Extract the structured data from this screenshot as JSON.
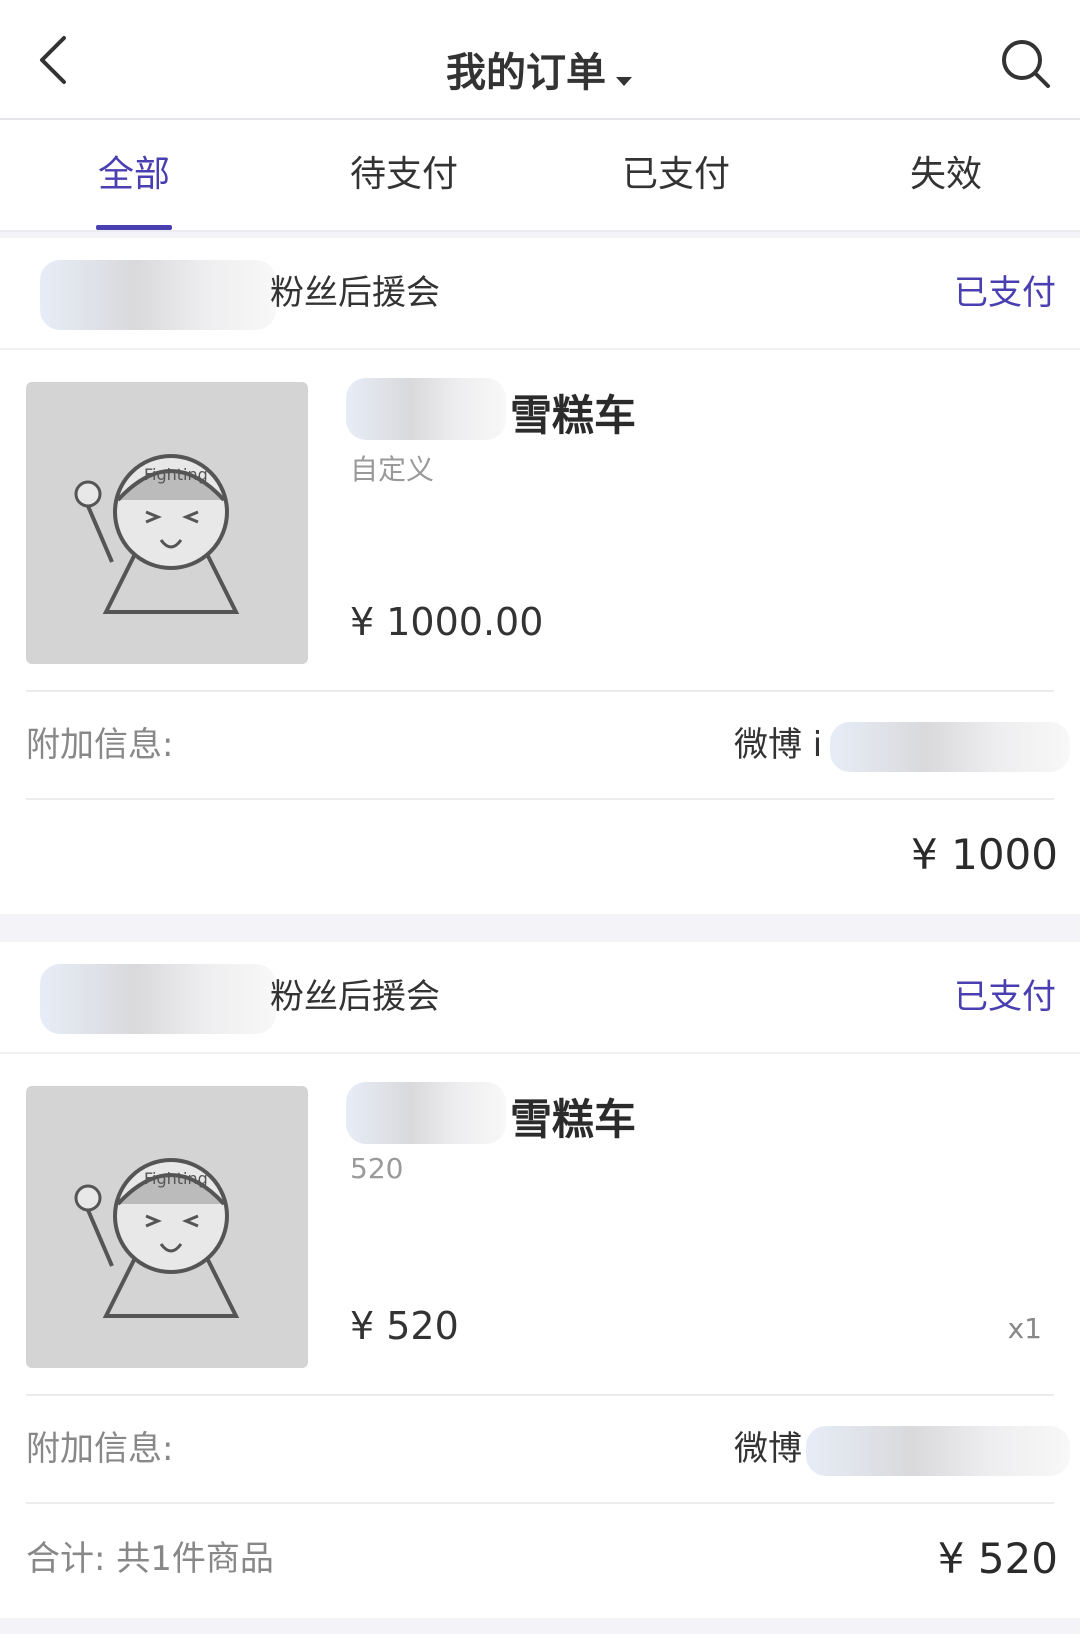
{
  "header": {
    "title": "我的订单",
    "back_icon": "chevron-left-icon",
    "search_icon": "search-icon",
    "caret_icon": "caret-down-icon"
  },
  "tabs": [
    {
      "label": "全部",
      "active": true
    },
    {
      "label": "待支付",
      "active": false
    },
    {
      "label": "已支付",
      "active": false
    },
    {
      "label": "失效",
      "active": false
    }
  ],
  "orders": [
    {
      "shop_name": "粉丝后援会",
      "status": "已支付",
      "product": {
        "name": "雪糕车",
        "spec": "自定义",
        "price": "¥ 1000.00",
        "qty": ""
      },
      "extra_label": "附加信息:",
      "extra_value": "微博 i",
      "total_label": "",
      "total_amount": "¥ 1000"
    },
    {
      "shop_name": "粉丝后援会",
      "status": "已支付",
      "product": {
        "name": "雪糕车",
        "spec": "520",
        "price": "¥ 520",
        "qty": "x1"
      },
      "extra_label": "附加信息:",
      "extra_value": "微博",
      "total_label": "合计: 共1件商品",
      "total_amount": "¥ 520"
    }
  ],
  "colors": {
    "accent": "#4a3fb0",
    "background": "#f3f3f8"
  }
}
